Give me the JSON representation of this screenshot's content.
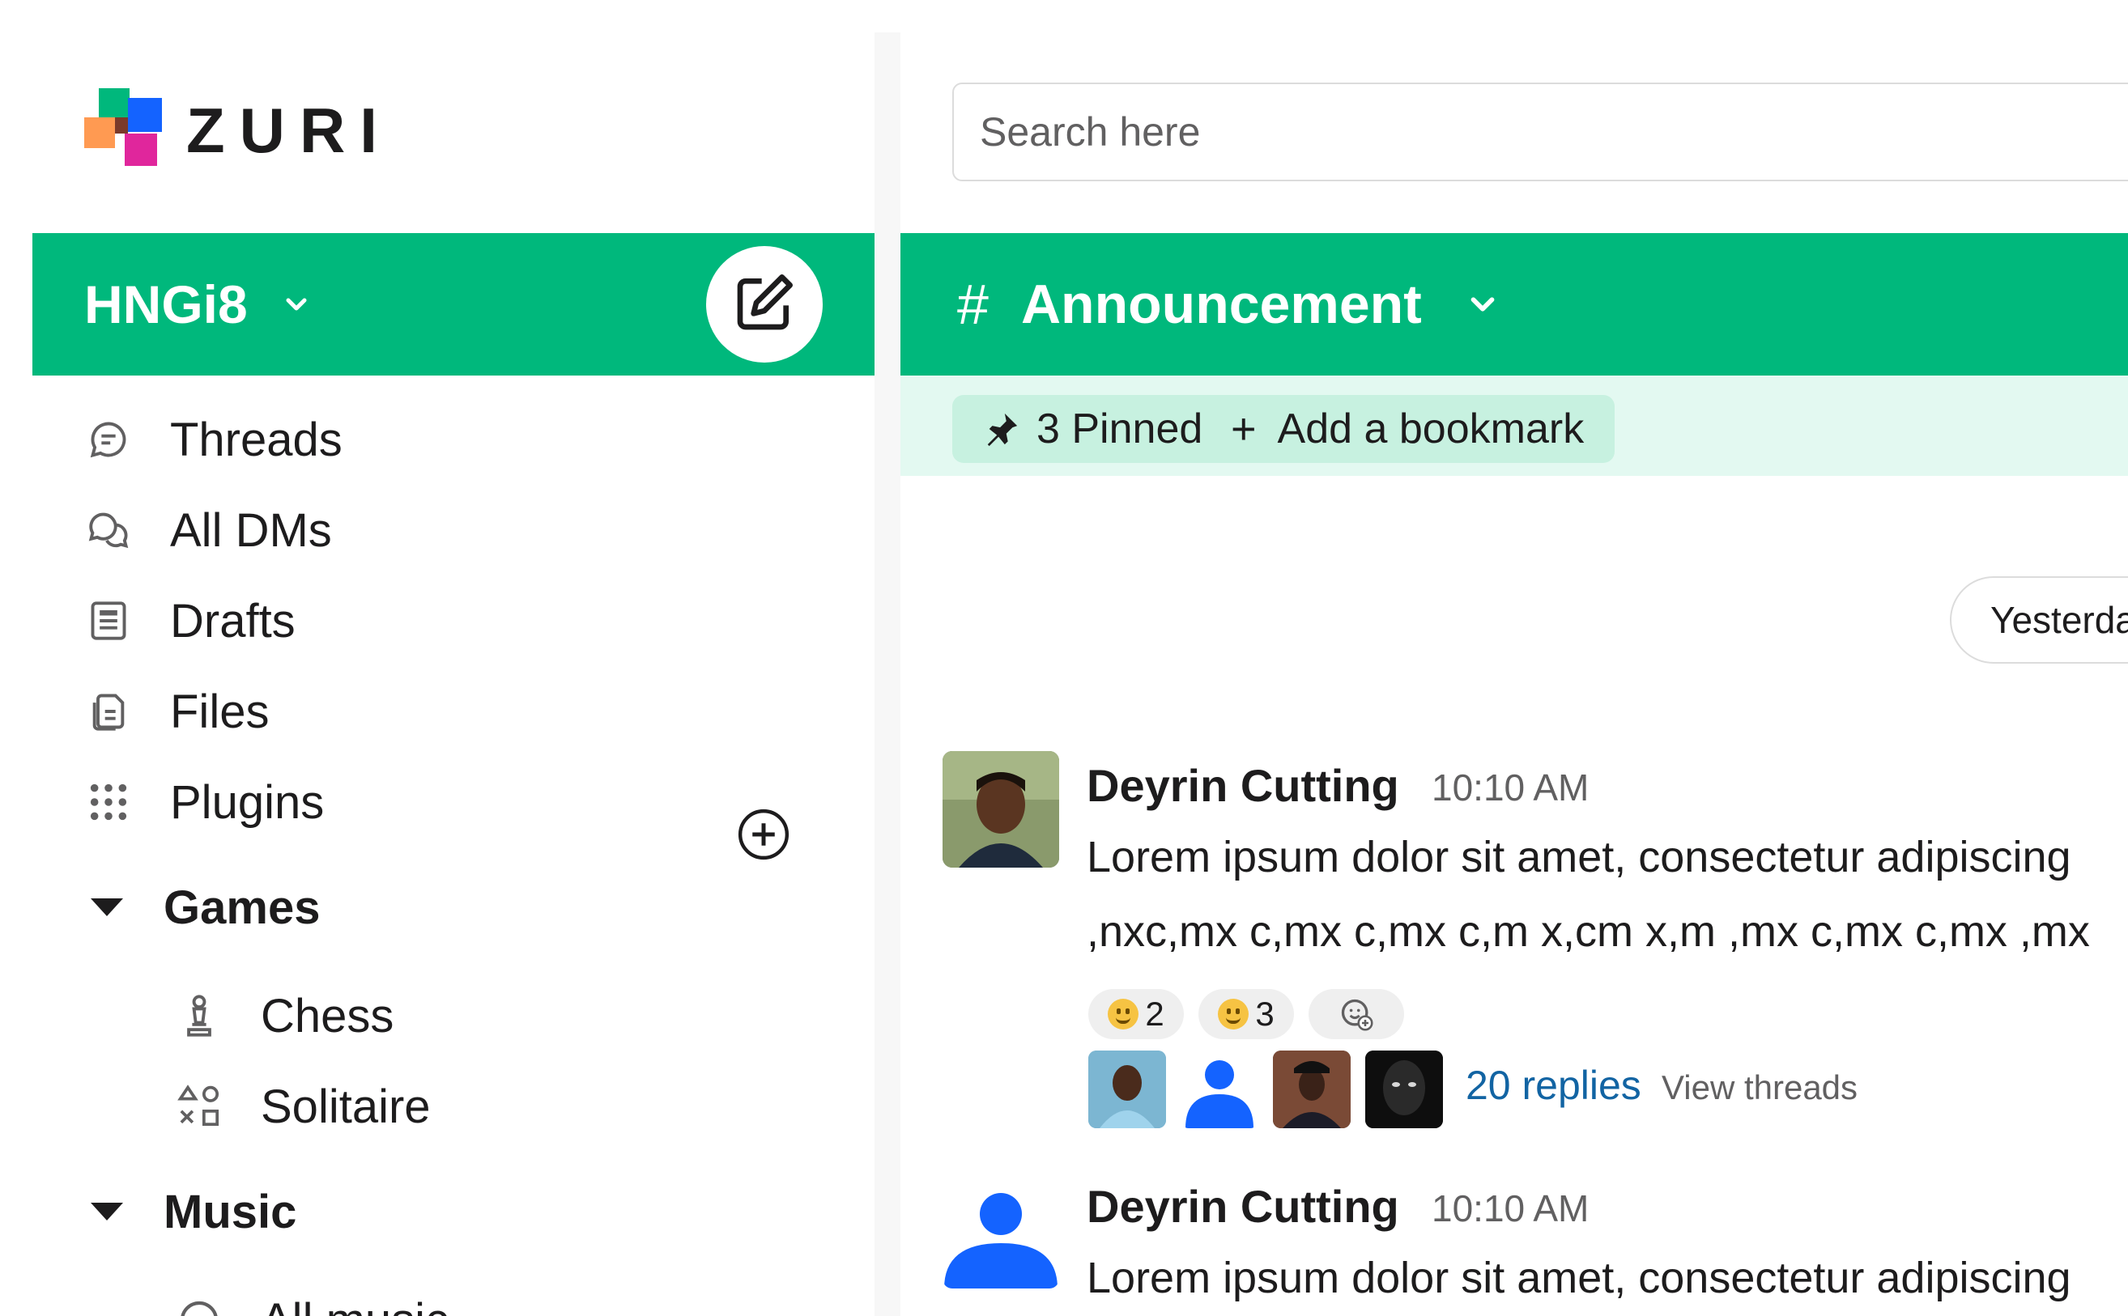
{
  "brand": {
    "name": "ZURI"
  },
  "workspace": {
    "name": "HNGi8"
  },
  "sidebar": {
    "items": [
      {
        "label": "Threads",
        "icon": "threads-icon"
      },
      {
        "label": "All DMs",
        "icon": "dms-icon"
      },
      {
        "label": "Drafts",
        "icon": "drafts-icon"
      },
      {
        "label": "Files",
        "icon": "files-icon"
      },
      {
        "label": "Plugins",
        "icon": "plugins-icon"
      }
    ],
    "sections": [
      {
        "title": "Games",
        "items": [
          {
            "label": "Chess",
            "icon": "chess-icon"
          },
          {
            "label": "Solitaire",
            "icon": "solitaire-icon"
          }
        ]
      },
      {
        "title": "Music",
        "items": [
          {
            "label": "All music",
            "icon": "headphones-icon"
          }
        ]
      }
    ]
  },
  "search": {
    "placeholder": "Search here"
  },
  "channel": {
    "name": "Announcement",
    "hash": "#",
    "pinned_label": "3 Pinned",
    "bookmark_label": "Add a bookmark",
    "bookmark_plus": "+"
  },
  "date_divider": "Yesterday",
  "messages": [
    {
      "author": "Deyrin Cutting",
      "time": "10:10 AM",
      "line1": "Lorem ipsum dolor sit amet, consectetur adipiscing",
      "line2": ",nxc,mx c,mx c,mx c,m x,cm x,m ,mx c,mx c,mx  ,mx",
      "reactions": [
        {
          "count": "2"
        },
        {
          "count": "3"
        }
      ],
      "replies": "20 replies",
      "view_threads": "View threads"
    },
    {
      "author": "Deyrin Cutting",
      "time": "10:10 AM",
      "line1": "Lorem ipsum dolor sit amet, consectetur adipiscing"
    }
  ],
  "colors": {
    "brand_green": "#00b87c",
    "bookmark_bg": "#e3f9f1",
    "link_blue": "#1264a3",
    "avatar_blue": "#1463ff"
  }
}
